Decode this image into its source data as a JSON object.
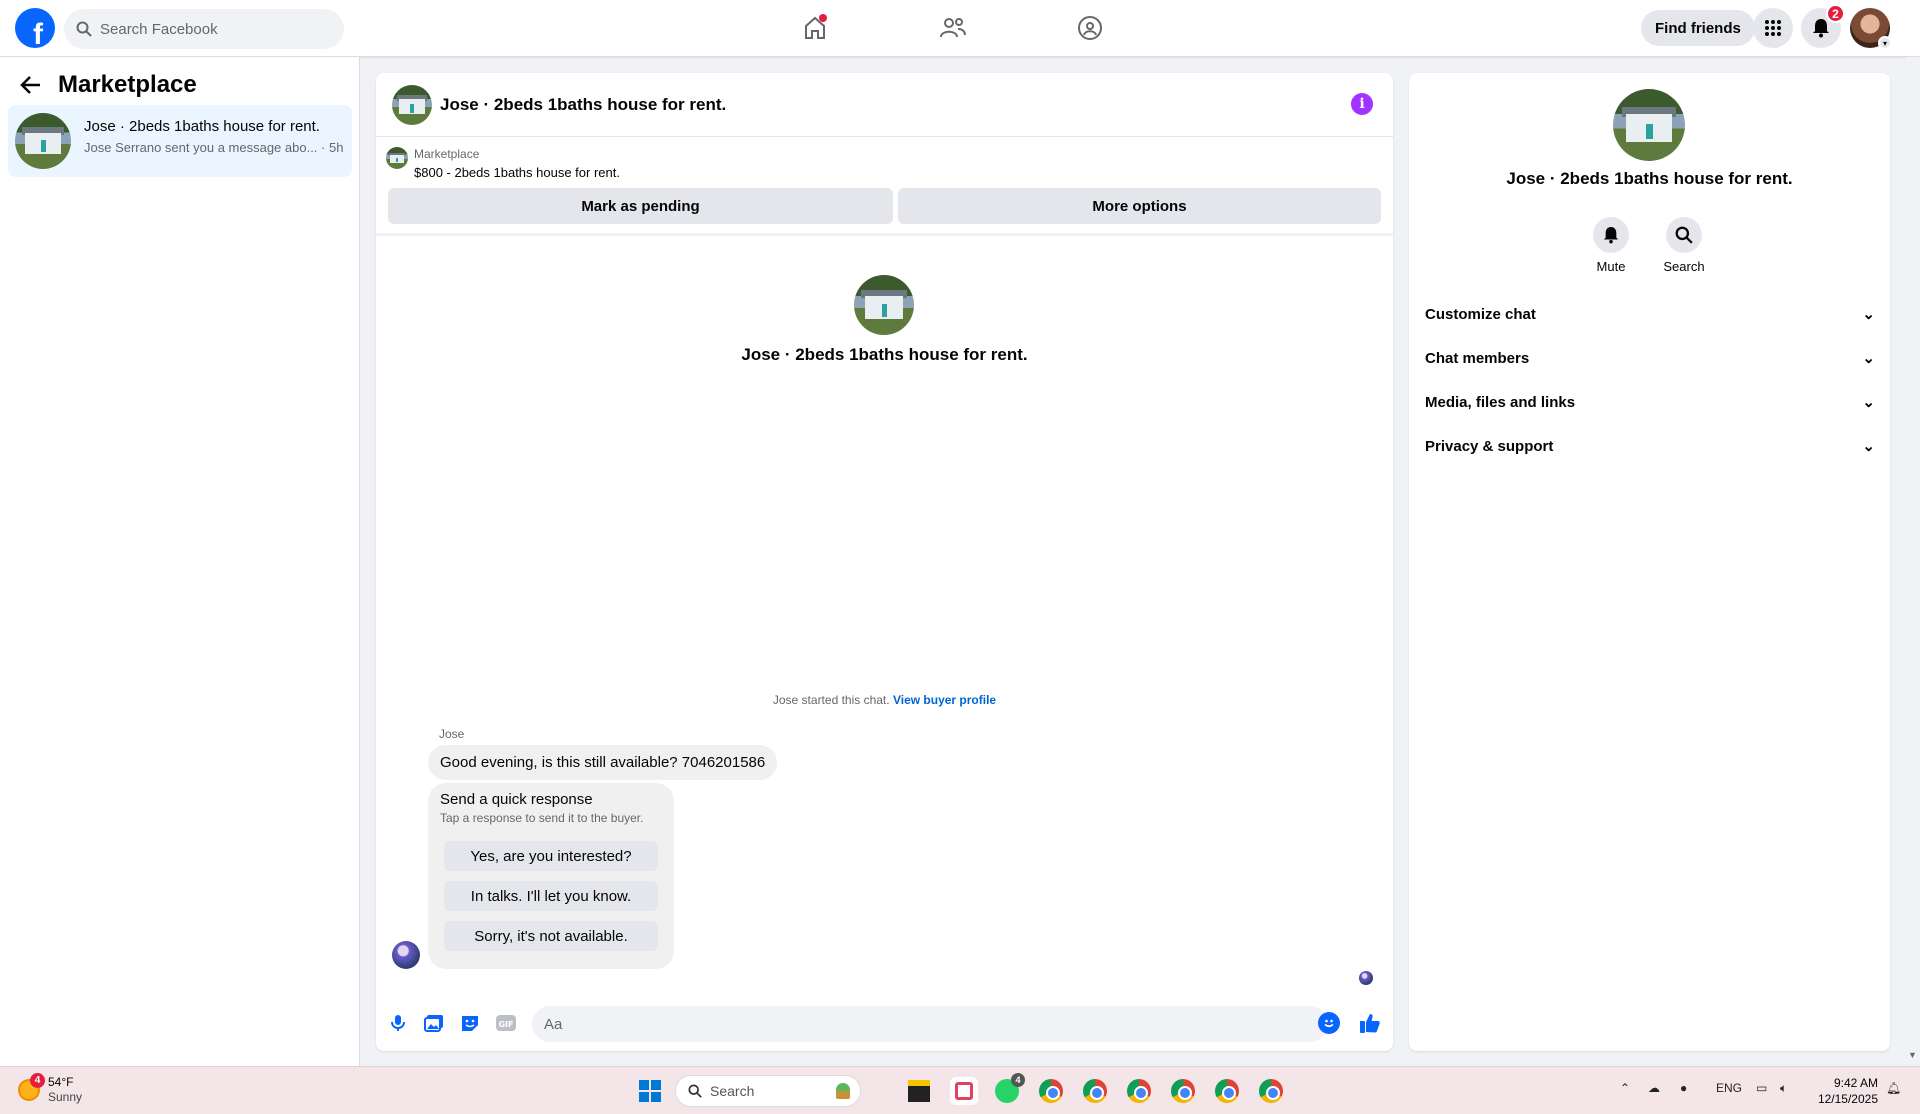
{
  "header": {
    "search_placeholder": "Search Facebook",
    "find_friends": "Find friends",
    "notifications_count": "2",
    "icons": [
      "facebook-logo",
      "home-icon",
      "friends-icon",
      "groups-icon",
      "menu-grid-icon",
      "bell-icon",
      "profile-avatar"
    ]
  },
  "sidebar": {
    "title": "Marketplace",
    "conversations": [
      {
        "name": "Jose · 2beds 1baths house for rent.",
        "preview": "Jose Serrano sent you a message abo...",
        "time": "5h"
      }
    ]
  },
  "chat": {
    "title": "Jose · 2beds 1baths house for rent.",
    "listing": {
      "source": "Marketplace",
      "title": "$800 - 2beds 1baths house for rent."
    },
    "buttons": {
      "mark_pending": "Mark as pending",
      "more_options": "More options"
    },
    "center_name": "Jose · 2beds 1baths house for rent.",
    "started_text": "Jose started this chat.",
    "view_buyer_profile": "View buyer profile",
    "message": {
      "sender": "Jose",
      "text": "Good evening, is this still available? 7046201586"
    },
    "quick_response": {
      "title": "Send a quick response",
      "subtitle": "Tap a response to send it to the buyer.",
      "options": [
        "Yes, are you interested?",
        "In talks. I'll let you know.",
        "Sorry, it's not available."
      ]
    },
    "composer_placeholder": "Aa"
  },
  "info_panel": {
    "name": "Jose · 2beds 1baths house for rent.",
    "actions": [
      "Mute",
      "Search"
    ],
    "sections": [
      "Customize chat",
      "Chat members",
      "Media, files and links",
      "Privacy & support"
    ]
  },
  "taskbar": {
    "weather_temp": "54°F",
    "weather_desc": "Sunny",
    "weather_badge": "4",
    "search_label": "Search",
    "whatsapp_badge": "4",
    "language": "ENG",
    "time": "9:42 AM",
    "date": "12/15/2025"
  },
  "colors": {
    "brand": "#0866ff",
    "info": "#a033ff",
    "badge": "#e41e3f",
    "link": "#0064d1"
  }
}
